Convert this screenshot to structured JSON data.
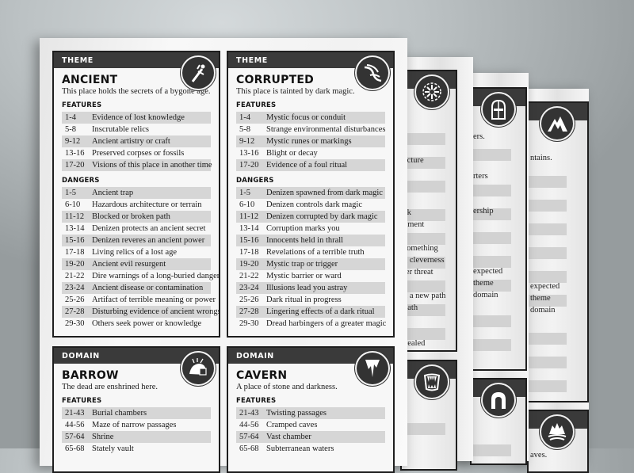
{
  "sheets": {
    "front": {
      "cards": [
        {
          "category": "THEME",
          "title": "ANCIENT",
          "icon": "ancient-sword-icon",
          "description": "This place holds the secrets of a bygone age.",
          "features_label": "FEATURES",
          "features": [
            {
              "range": "1-4",
              "text": "Evidence of lost knowledge"
            },
            {
              "range": "5-8",
              "text": "Inscrutable relics"
            },
            {
              "range": "9-12",
              "text": "Ancient artistry or craft"
            },
            {
              "range": "13-16",
              "text": "Preserved corpses or fossils"
            },
            {
              "range": "17-20",
              "text": "Visions of this place in another time"
            }
          ],
          "dangers_label": "DANGERS",
          "dangers": [
            {
              "range": "1-5",
              "text": "Ancient trap"
            },
            {
              "range": "6-10",
              "text": "Hazardous architecture or terrain"
            },
            {
              "range": "11-12",
              "text": "Blocked or broken path"
            },
            {
              "range": "13-14",
              "text": "Denizen protects an ancient secret"
            },
            {
              "range": "15-16",
              "text": "Denizen reveres an ancient power"
            },
            {
              "range": "17-18",
              "text": "Living relics of a lost age"
            },
            {
              "range": "19-20",
              "text": "Ancient evil resurgent"
            },
            {
              "range": "21-22",
              "text": "Dire warnings of a long-buried danger"
            },
            {
              "range": "23-24",
              "text": "Ancient disease or contamination"
            },
            {
              "range": "25-26",
              "text": "Artifact of terrible meaning or power"
            },
            {
              "range": "27-28",
              "text": "Disturbing evidence of ancient wrongs"
            },
            {
              "range": "29-30",
              "text": "Others seek power or knowledge"
            }
          ]
        },
        {
          "category": "THEME",
          "title": "CORRUPTED",
          "icon": "corrupted-tendril-icon",
          "description": "This place is tainted by dark magic.",
          "features_label": "FEATURES",
          "features": [
            {
              "range": "1-4",
              "text": "Mystic focus or conduit"
            },
            {
              "range": "5-8",
              "text": "Strange environmental disturbances"
            },
            {
              "range": "9-12",
              "text": "Mystic runes or markings"
            },
            {
              "range": "13-16",
              "text": "Blight or decay"
            },
            {
              "range": "17-20",
              "text": "Evidence of a foul ritual"
            }
          ],
          "dangers_label": "DANGERS",
          "dangers": [
            {
              "range": "1-5",
              "text": "Denizen spawned from dark magic"
            },
            {
              "range": "6-10",
              "text": "Denizen controls dark magic"
            },
            {
              "range": "11-12",
              "text": "Denizen corrupted by dark magic"
            },
            {
              "range": "13-14",
              "text": "Corruption marks you"
            },
            {
              "range": "15-16",
              "text": "Innocents held in thrall"
            },
            {
              "range": "17-18",
              "text": "Revelations of a terrible truth"
            },
            {
              "range": "19-20",
              "text": "Mystic trap or trigger"
            },
            {
              "range": "21-22",
              "text": "Mystic barrier or ward"
            },
            {
              "range": "23-24",
              "text": "Illusions lead you astray"
            },
            {
              "range": "25-26",
              "text": "Dark ritual in progress"
            },
            {
              "range": "27-28",
              "text": "Lingering effects of a dark ritual"
            },
            {
              "range": "29-30",
              "text": "Dread harbingers of a greater magic"
            }
          ]
        },
        {
          "category": "DOMAIN",
          "title": "BARROW",
          "icon": "barrow-tomb-icon",
          "description": "The dead are enshrined here.",
          "features_label": "FEATURES",
          "features": [
            {
              "range": "21-43",
              "text": "Burial chambers"
            },
            {
              "range": "44-56",
              "text": "Maze of narrow passages"
            },
            {
              "range": "57-64",
              "text": "Shrine"
            },
            {
              "range": "65-68",
              "text": "Stately vault"
            }
          ]
        },
        {
          "category": "DOMAIN",
          "title": "CAVERN",
          "icon": "cavern-stalactite-icon",
          "description": "A place of stone and darkness.",
          "features_label": "FEATURES",
          "features": [
            {
              "range": "21-43",
              "text": "Twisting passages"
            },
            {
              "range": "44-56",
              "text": "Cramped caves"
            },
            {
              "range": "57-64",
              "text": "Vast chamber"
            },
            {
              "range": "65-68",
              "text": "Subterranean waters"
            }
          ]
        }
      ]
    },
    "back1": {
      "top_icon": "compass-wheel-icon",
      "bottom_icon": "fanged-maw-icon",
      "partial_lines": [
        "ecture",
        "ck",
        "nment",
        "something",
        "g cleverness",
        "ter threat",
        "n a new path",
        "path",
        "vealed"
      ]
    },
    "back2": {
      "top_icon": "arched-door-icon",
      "bottom_icon": "stone-arch-icon",
      "partial_lines": [
        "ers.",
        "rters",
        "ership",
        "expected",
        "theme",
        "domain"
      ]
    },
    "back3": {
      "top_icon": "mountain-peaks-icon",
      "bottom_icon": "cave-waters-icon",
      "partial_lines": [
        "ntains.",
        "expected",
        "theme",
        "domain",
        "aves."
      ]
    }
  }
}
